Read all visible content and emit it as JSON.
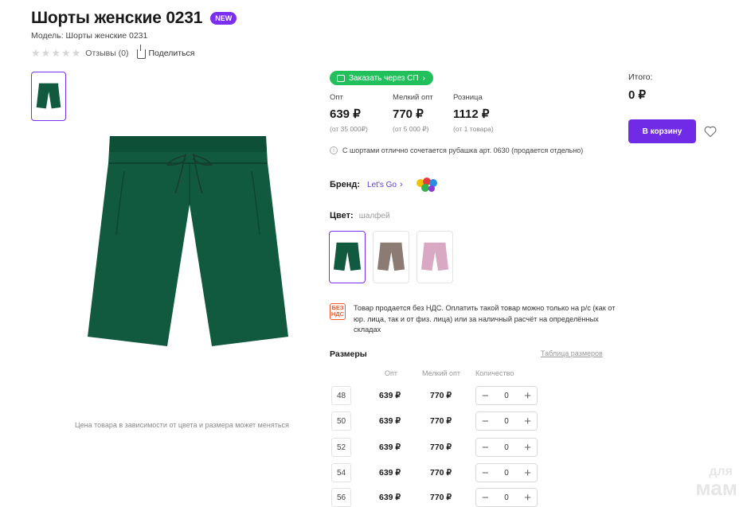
{
  "product": {
    "title": "Шорты женские 0231",
    "badge": "NEW",
    "model": "Модель: Шорты женские 0231",
    "reviews": "Отзывы (0)",
    "share": "Поделиться",
    "rating_stars": 0,
    "price_note": "Цена товара в зависимости от цвета и размера может меняться"
  },
  "order_sp": {
    "label": "Заказать через СП"
  },
  "prices": [
    {
      "label": "Опт",
      "value": "639 ₽",
      "sub": "(от 35 000₽)"
    },
    {
      "label": "Мелкий опт",
      "value": "770 ₽",
      "sub": "(от 5 000 ₽)"
    },
    {
      "label": "Розница",
      "value": "1112 ₽",
      "sub": "(от 1 товара)"
    }
  ],
  "info_note": "С шортами отлично сочетается рубашка арт. 0630 (продается отдельно)",
  "brand": {
    "label": "Бренд:",
    "name": "Let's Go"
  },
  "color": {
    "label": "Цвет:",
    "value": "шалфей",
    "swatches": [
      "#115a40",
      "#8c7b72",
      "#d9a9c4"
    ]
  },
  "nds": {
    "logo": "БЕЗ НДС",
    "text": "Товар продается без НДС. Оплатить такой товар можно только на р/с (как от юр. лица, так и от физ. лица) или за наличный расчёт на определённых складах"
  },
  "sizes": {
    "title": "Размеры",
    "table_link": "Таблица размеров",
    "headers": {
      "opt": "Опт",
      "small_opt": "Мелкий опт",
      "qty": "Количество"
    },
    "rows": [
      {
        "size": "48",
        "opt": "639 ₽",
        "small_opt": "770 ₽",
        "qty": "0"
      },
      {
        "size": "50",
        "opt": "639 ₽",
        "small_opt": "770 ₽",
        "qty": "0"
      },
      {
        "size": "52",
        "opt": "639 ₽",
        "small_opt": "770 ₽",
        "qty": "0"
      },
      {
        "size": "54",
        "opt": "639 ₽",
        "small_opt": "770 ₽",
        "qty": "0"
      },
      {
        "size": "56",
        "opt": "639 ₽",
        "small_opt": "770 ₽",
        "qty": "0"
      }
    ],
    "minus": "−",
    "plus": "+"
  },
  "summary": {
    "total_label": "Итого:",
    "total_value": "0 ₽",
    "cart_button": "В корзину"
  },
  "watermark": {
    "top": "для",
    "bottom": "мам"
  },
  "colors": {
    "accent": "#7b2ff0",
    "sp_green": "#21c05b",
    "product_green": "#115a40"
  }
}
